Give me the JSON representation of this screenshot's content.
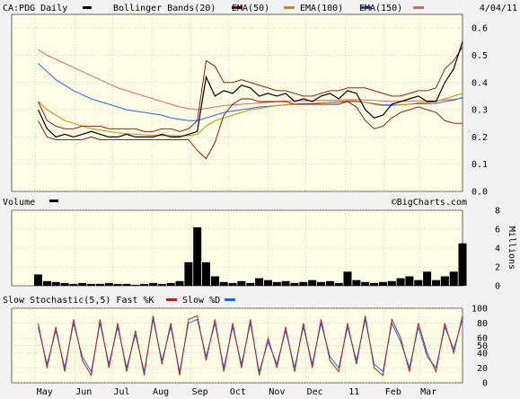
{
  "chart_data": [
    {
      "type": "line",
      "panel": "price",
      "symbol_label": "CA:PDG Daily",
      "date_label": "4/04/11",
      "legend": [
        {
          "label": "Bollinger Bands(20)",
          "color": "#8b0000"
        },
        {
          "label": "EMA(50)",
          "color": "#cc8800"
        },
        {
          "label": "EMA(100)",
          "color": "#2266ee"
        },
        {
          "label": "EMA(150)",
          "color": "#dd6666"
        }
      ],
      "price_color": "#000000",
      "ylim": [
        0.0,
        0.65
      ],
      "y_ticks": [
        "0.0",
        "0.1",
        "0.2",
        "0.3",
        "0.4",
        "0.5",
        "0.6"
      ],
      "x_ticks": [
        "May",
        "Jun",
        "Jul",
        "Aug",
        "Sep",
        "Oct",
        "Nov",
        "Dec",
        "11",
        "Feb",
        "Mar"
      ],
      "x_dates": [
        "2010-05-03",
        "2010-05-10",
        "2010-05-17",
        "2010-05-24",
        "2010-05-31",
        "2010-06-07",
        "2010-06-14",
        "2010-06-21",
        "2010-06-28",
        "2010-07-05",
        "2010-07-12",
        "2010-07-19",
        "2010-07-26",
        "2010-08-02",
        "2010-08-09",
        "2010-08-16",
        "2010-08-23",
        "2010-08-30",
        "2010-09-06",
        "2010-09-13",
        "2010-09-20",
        "2010-09-27",
        "2010-10-04",
        "2010-10-11",
        "2010-10-18",
        "2010-10-25",
        "2010-11-01",
        "2010-11-08",
        "2010-11-15",
        "2010-11-22",
        "2010-11-29",
        "2010-12-06",
        "2010-12-13",
        "2010-12-20",
        "2010-12-27",
        "2011-01-03",
        "2011-01-10",
        "2011-01-17",
        "2011-01-24",
        "2011-01-31",
        "2011-02-07",
        "2011-02-14",
        "2011-02-21",
        "2011-02-28",
        "2011-03-07",
        "2011-03-14",
        "2011-03-21",
        "2011-03-28",
        "2011-04-04"
      ],
      "x_range": [
        "2010-04-12",
        "2011-04-04"
      ],
      "series": [
        {
          "name": "CA:PDG",
          "values": [
            0.3,
            0.23,
            0.2,
            0.21,
            0.2,
            0.21,
            0.22,
            0.21,
            0.2,
            0.2,
            0.21,
            0.2,
            0.2,
            0.2,
            0.21,
            0.2,
            0.2,
            0.21,
            0.22,
            0.42,
            0.35,
            0.37,
            0.36,
            0.39,
            0.38,
            0.35,
            0.36,
            0.35,
            0.36,
            0.33,
            0.34,
            0.33,
            0.35,
            0.36,
            0.34,
            0.37,
            0.36,
            0.3,
            0.27,
            0.28,
            0.32,
            0.33,
            0.34,
            0.35,
            0.33,
            0.33,
            0.4,
            0.45,
            0.55
          ]
        },
        {
          "name": "Bollinger Bands(20) upper",
          "values": [
            0.33,
            0.26,
            0.24,
            0.23,
            0.23,
            0.24,
            0.24,
            0.24,
            0.23,
            0.23,
            0.23,
            0.23,
            0.22,
            0.22,
            0.23,
            0.23,
            0.22,
            0.23,
            0.26,
            0.48,
            0.46,
            0.4,
            0.4,
            0.41,
            0.4,
            0.39,
            0.38,
            0.37,
            0.37,
            0.36,
            0.35,
            0.35,
            0.36,
            0.37,
            0.37,
            0.38,
            0.38,
            0.38,
            0.37,
            0.36,
            0.35,
            0.35,
            0.36,
            0.37,
            0.37,
            0.38,
            0.45,
            0.48,
            0.53
          ]
        },
        {
          "name": "Bollinger Bands(20) lower",
          "values": [
            0.26,
            0.2,
            0.19,
            0.19,
            0.19,
            0.19,
            0.2,
            0.19,
            0.19,
            0.19,
            0.19,
            0.19,
            0.19,
            0.19,
            0.19,
            0.19,
            0.19,
            0.19,
            0.15,
            0.12,
            0.18,
            0.28,
            0.32,
            0.34,
            0.34,
            0.33,
            0.33,
            0.33,
            0.33,
            0.32,
            0.32,
            0.32,
            0.32,
            0.32,
            0.32,
            0.33,
            0.31,
            0.26,
            0.23,
            0.24,
            0.27,
            0.29,
            0.3,
            0.31,
            0.3,
            0.29,
            0.26,
            0.25,
            0.25
          ]
        },
        {
          "name": "EMA(50)",
          "values": [
            0.33,
            0.3,
            0.28,
            0.26,
            0.25,
            0.24,
            0.23,
            0.225,
            0.22,
            0.215,
            0.212,
            0.21,
            0.208,
            0.206,
            0.205,
            0.205,
            0.204,
            0.205,
            0.21,
            0.24,
            0.26,
            0.27,
            0.28,
            0.29,
            0.3,
            0.305,
            0.31,
            0.315,
            0.318,
            0.32,
            0.322,
            0.322,
            0.325,
            0.328,
            0.33,
            0.333,
            0.333,
            0.327,
            0.32,
            0.315,
            0.315,
            0.318,
            0.32,
            0.325,
            0.327,
            0.33,
            0.34,
            0.35,
            0.36
          ]
        },
        {
          "name": "EMA(100)",
          "values": [
            0.47,
            0.44,
            0.41,
            0.39,
            0.37,
            0.355,
            0.34,
            0.33,
            0.32,
            0.31,
            0.3,
            0.295,
            0.29,
            0.285,
            0.28,
            0.27,
            0.265,
            0.26,
            0.26,
            0.27,
            0.28,
            0.29,
            0.295,
            0.3,
            0.305,
            0.31,
            0.312,
            0.315,
            0.318,
            0.32,
            0.322,
            0.323,
            0.325,
            0.327,
            0.328,
            0.33,
            0.33,
            0.327,
            0.322,
            0.318,
            0.317,
            0.318,
            0.32,
            0.322,
            0.322,
            0.323,
            0.33,
            0.335,
            0.345
          ]
        },
        {
          "name": "EMA(150)",
          "values": [
            0.52,
            0.5,
            0.485,
            0.47,
            0.455,
            0.44,
            0.425,
            0.41,
            0.395,
            0.38,
            0.37,
            0.36,
            0.35,
            0.34,
            0.33,
            0.32,
            0.31,
            0.305,
            0.3,
            0.305,
            0.31,
            0.315,
            0.318,
            0.32,
            0.322,
            0.325,
            0.327,
            0.33,
            0.332,
            0.333,
            0.333,
            0.333,
            0.334,
            0.335,
            0.336,
            0.337,
            0.337,
            0.336,
            0.334,
            0.332,
            0.331,
            0.331,
            0.332,
            0.333,
            0.333,
            0.333,
            0.336,
            0.338,
            0.342
          ]
        }
      ]
    },
    {
      "type": "bar",
      "panel": "volume",
      "label": "Volume",
      "watermark": "©BigCharts.com",
      "unit_label": "Millions",
      "ylim": [
        0,
        8
      ],
      "y_ticks": [
        "0",
        "2",
        "4",
        "6",
        "8"
      ],
      "x_dates": [
        "2010-05-03",
        "2010-05-10",
        "2010-05-17",
        "2010-05-24",
        "2010-05-31",
        "2010-06-07",
        "2010-06-14",
        "2010-06-21",
        "2010-06-28",
        "2010-07-05",
        "2010-07-12",
        "2010-07-19",
        "2010-07-26",
        "2010-08-02",
        "2010-08-09",
        "2010-08-16",
        "2010-08-23",
        "2010-08-30",
        "2010-09-06",
        "2010-09-13",
        "2010-09-20",
        "2010-09-27",
        "2010-10-04",
        "2010-10-11",
        "2010-10-18",
        "2010-10-25",
        "2010-11-01",
        "2010-11-08",
        "2010-11-15",
        "2010-11-22",
        "2010-11-29",
        "2010-12-06",
        "2010-12-13",
        "2010-12-20",
        "2010-12-27",
        "2011-01-03",
        "2011-01-10",
        "2011-01-17",
        "2011-01-24",
        "2011-01-31",
        "2011-02-07",
        "2011-02-14",
        "2011-02-21",
        "2011-02-28",
        "2011-03-07",
        "2011-03-14",
        "2011-03-21",
        "2011-03-28",
        "2011-04-04"
      ],
      "values": [
        1.2,
        0.5,
        0.4,
        0.3,
        0.2,
        0.3,
        0.2,
        0.2,
        0.3,
        0.2,
        0.2,
        0.1,
        0.2,
        0.3,
        0.2,
        0.3,
        0.5,
        2.5,
        6.2,
        2.5,
        1.0,
        0.4,
        0.3,
        0.5,
        0.3,
        0.8,
        0.6,
        0.4,
        0.5,
        0.3,
        0.4,
        0.6,
        0.4,
        0.5,
        0.3,
        1.5,
        0.6,
        0.4,
        0.3,
        0.4,
        0.5,
        0.8,
        1.0,
        0.6,
        1.5,
        0.6,
        1.0,
        1.5,
        4.5
      ]
    },
    {
      "type": "line",
      "panel": "stochastic",
      "label": "Slow Stochastic(5,5) Fast %K",
      "k_label": "Slow %D",
      "k_color": "#aa2222",
      "d_color": "#2266ee",
      "ylim": [
        0,
        100
      ],
      "y_ticks": [
        "0",
        "20",
        "40",
        "50",
        "60",
        "80",
        "100"
      ],
      "x_dates": [
        "2010-05-03",
        "2010-05-10",
        "2010-05-17",
        "2010-05-24",
        "2010-05-31",
        "2010-06-07",
        "2010-06-14",
        "2010-06-21",
        "2010-06-28",
        "2010-07-05",
        "2010-07-12",
        "2010-07-19",
        "2010-07-26",
        "2010-08-02",
        "2010-08-09",
        "2010-08-16",
        "2010-08-23",
        "2010-08-30",
        "2010-09-06",
        "2010-09-13",
        "2010-09-20",
        "2010-09-27",
        "2010-10-04",
        "2010-10-11",
        "2010-10-18",
        "2010-10-25",
        "2010-11-01",
        "2010-11-08",
        "2010-11-15",
        "2010-11-22",
        "2010-11-29",
        "2010-12-06",
        "2010-12-13",
        "2010-12-20",
        "2010-12-27",
        "2011-01-03",
        "2011-01-10",
        "2011-01-17",
        "2011-01-24",
        "2011-01-31",
        "2011-02-07",
        "2011-02-14",
        "2011-02-21",
        "2011-02-28",
        "2011-03-07",
        "2011-03-14",
        "2011-03-21",
        "2011-03-28",
        "2011-04-04"
      ],
      "series": [
        {
          "name": "Fast %K",
          "values": [
            80,
            20,
            75,
            15,
            85,
            30,
            10,
            85,
            20,
            80,
            15,
            70,
            10,
            90,
            25,
            80,
            10,
            85,
            90,
            30,
            85,
            15,
            80,
            20,
            85,
            10,
            60,
            20,
            75,
            15,
            80,
            20,
            85,
            30,
            15,
            80,
            25,
            90,
            20,
            10,
            85,
            60,
            15,
            80,
            40,
            15,
            80,
            40,
            90
          ]
        },
        {
          "name": "Slow %D",
          "values": [
            75,
            25,
            70,
            20,
            80,
            35,
            15,
            80,
            25,
            75,
            20,
            65,
            15,
            85,
            30,
            75,
            15,
            80,
            85,
            35,
            80,
            20,
            75,
            25,
            80,
            15,
            55,
            25,
            70,
            20,
            75,
            25,
            80,
            35,
            20,
            75,
            30,
            85,
            25,
            15,
            80,
            55,
            20,
            75,
            35,
            20,
            75,
            45,
            85
          ]
        }
      ]
    }
  ]
}
